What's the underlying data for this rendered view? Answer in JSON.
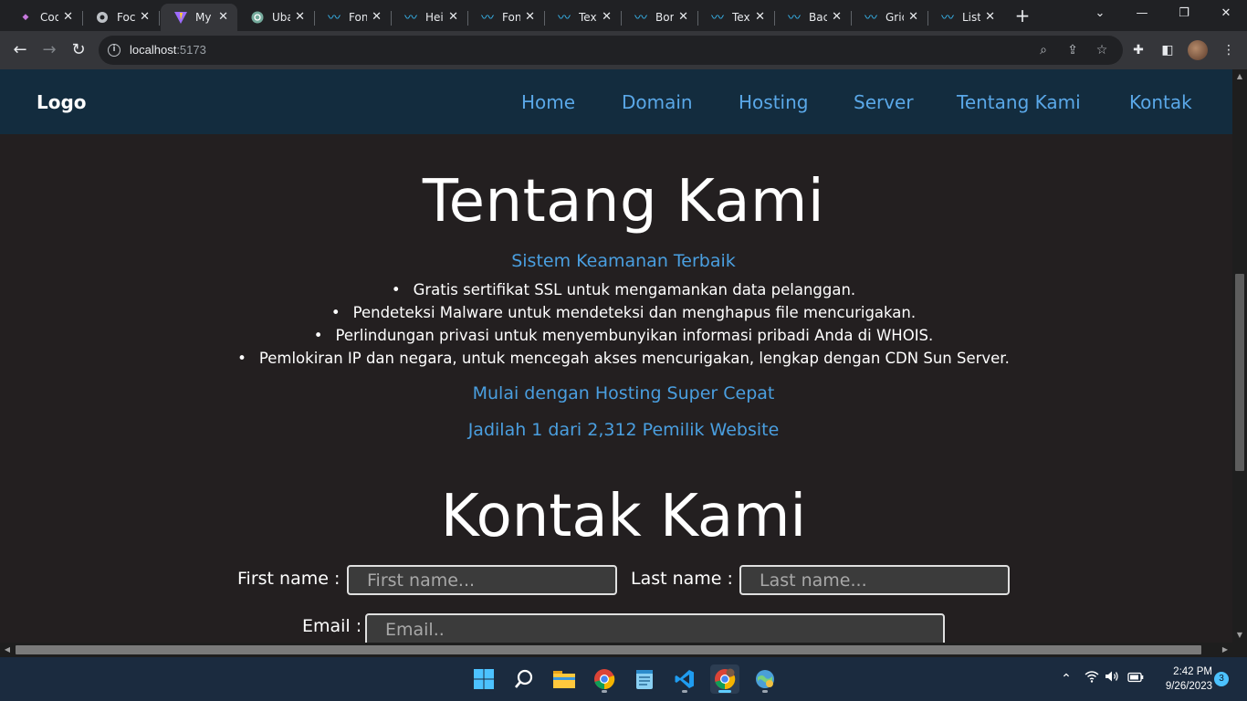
{
  "browser": {
    "tabs": [
      {
        "label": "Cod",
        "icon": "codepen-icon"
      },
      {
        "label": "Foc",
        "icon": "globe-icon"
      },
      {
        "label": "My",
        "icon": "vite-icon",
        "active": true
      },
      {
        "label": "Uba",
        "icon": "chatgpt-icon"
      },
      {
        "label": "Fon",
        "icon": "tailwind-icon"
      },
      {
        "label": "Hei",
        "icon": "tailwind-icon"
      },
      {
        "label": "Fon",
        "icon": "tailwind-icon"
      },
      {
        "label": "Text",
        "icon": "tailwind-icon"
      },
      {
        "label": "Bor",
        "icon": "tailwind-icon"
      },
      {
        "label": "Text",
        "icon": "tailwind-icon"
      },
      {
        "label": "Bac",
        "icon": "tailwind-icon"
      },
      {
        "label": "Grid",
        "icon": "tailwind-icon"
      },
      {
        "label": "List",
        "icon": "tailwind-icon"
      }
    ],
    "url_host": "localhost",
    "url_port": ":5173"
  },
  "site": {
    "logo": "Logo",
    "nav": [
      "Home",
      "Domain",
      "Hosting",
      "Server",
      "Tentang Kami",
      "Kontak"
    ],
    "accent_color": "#5aa8e8",
    "navbar_color": "#132c3e",
    "background_color": "#231f20"
  },
  "about": {
    "title": "Tentang Kami",
    "subtitle": "Sistem Keamanan Terbaik",
    "features": [
      "Gratis sertifikat SSL untuk mengamankan data pelanggan.",
      "Pendeteksi Malware untuk mendeteksi dan menghapus file mencurigakan.",
      "Perlindungan privasi untuk menyembunyikan informasi pribadi Anda di WHOIS.",
      "Pemlokiran IP dan negara, untuk mencegah akses mencurigakan, lengkap dengan CDN Sun Server."
    ],
    "cta_1": "Mulai dengan Hosting Super Cepat",
    "cta_2": "Jadilah 1 dari 2,312 Pemilik Website"
  },
  "contact": {
    "title": "Kontak Kami",
    "first_name_label": "First name :",
    "first_name_placeholder": "First name...",
    "last_name_label": "Last name :",
    "last_name_placeholder": "Last name...",
    "email_label": "Email :",
    "email_placeholder": "Email.."
  },
  "taskbar": {
    "apps": [
      "windows-start-icon",
      "search-icon",
      "file-explorer-icon",
      "chrome-icon",
      "notepad-icon",
      "vscode-icon",
      "chrome-profile-icon",
      "browser-app-icon"
    ],
    "time": "2:42 PM",
    "date": "9/26/2023",
    "notification_count": "3"
  }
}
